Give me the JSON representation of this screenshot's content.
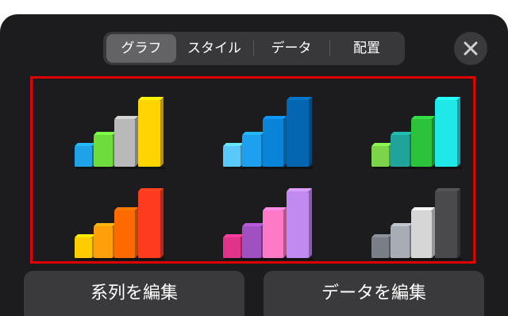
{
  "tabs": [
    {
      "label": "グラフ",
      "selected": true
    },
    {
      "label": "スタイル",
      "selected": false
    },
    {
      "label": "データ",
      "selected": false
    },
    {
      "label": "配置",
      "selected": false
    }
  ],
  "close_icon": "close-icon",
  "chart_styles": [
    {
      "name": "style-multicolor",
      "colors": [
        "#1fa2e8",
        "#6edc3c",
        "#b9b9b9",
        "#ffd400"
      ]
    },
    {
      "name": "style-blue",
      "colors": [
        "#5ac8fa",
        "#1ea0f0",
        "#0a84d8",
        "#0466b0"
      ]
    },
    {
      "name": "style-green-teal",
      "colors": [
        "#7bd44a",
        "#1fa39a",
        "#2cc23c",
        "#20e8e8"
      ]
    },
    {
      "name": "style-orange",
      "colors": [
        "#ffcc00",
        "#ff9f0a",
        "#ff6a00",
        "#ff3b1f"
      ]
    },
    {
      "name": "style-pink-purple",
      "colors": [
        "#e0348a",
        "#a050c0",
        "#ff7ac6",
        "#c08af0"
      ]
    },
    {
      "name": "style-gray",
      "colors": [
        "#7a7f87",
        "#a8adb5",
        "#d6d6d6",
        "#4a4a4c"
      ]
    }
  ],
  "buttons": {
    "edit_series": "系列を編集",
    "edit_data": "データを編集"
  }
}
